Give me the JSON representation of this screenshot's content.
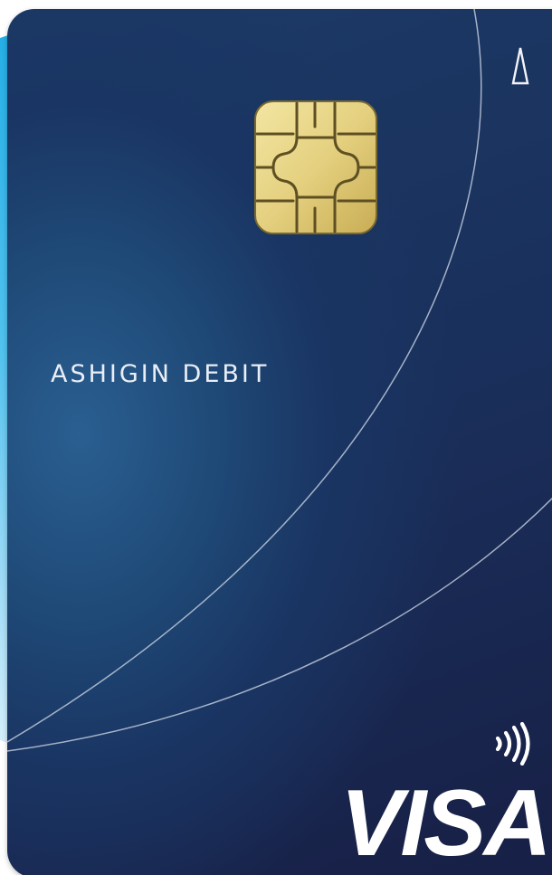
{
  "card": {
    "name": "ASHIGIN DEBIT",
    "network_logo": "VISA",
    "corner_icon": "triangle-outline-icon",
    "chip_icon": "emv-chip-icon",
    "contactless_icon": "contactless-icon",
    "colors": {
      "card_base": "#1a2f5b",
      "card_highlight": "#2a5f91",
      "chip_gold": "#e8d889",
      "text": "#e9eef6",
      "backdrop_blue": "#24aee6"
    }
  }
}
